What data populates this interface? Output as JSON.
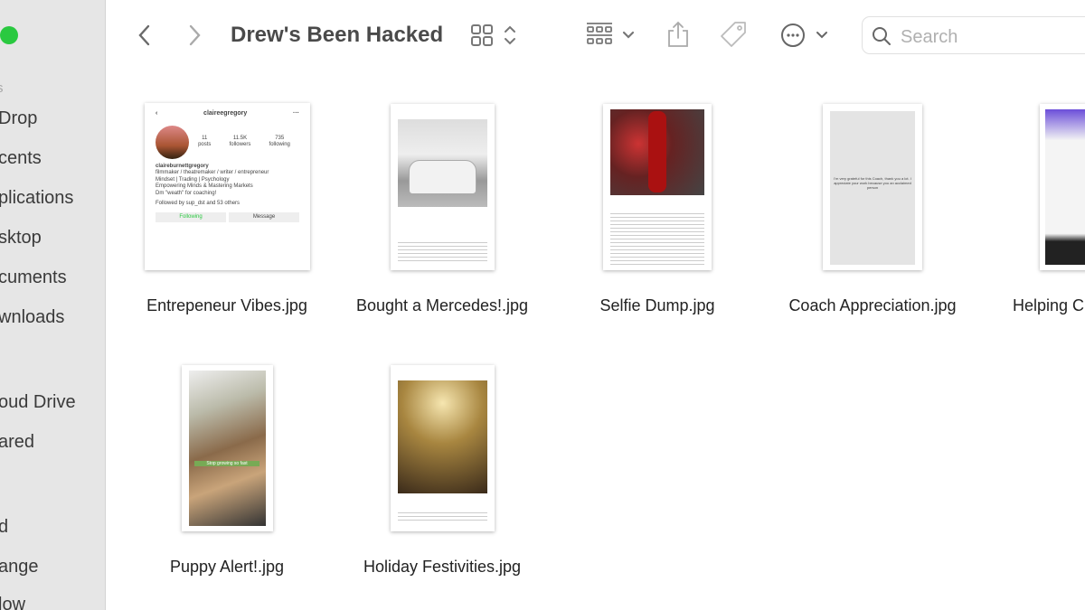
{
  "window": {
    "title": "Drew's Been Hacked"
  },
  "sidebar": {
    "section_favorites": "s",
    "items": [
      {
        "label": "Drop"
      },
      {
        "label": "cents"
      },
      {
        "label": "plications"
      },
      {
        "label": "sktop"
      },
      {
        "label": "cuments"
      },
      {
        "label": "wnloads"
      },
      {
        "label": "oud Drive"
      },
      {
        "label": "ared"
      },
      {
        "label": "d"
      },
      {
        "label": "ange"
      },
      {
        "label": "low"
      }
    ]
  },
  "toolbar": {
    "back_icon": "chevron-left",
    "forward_icon": "chevron-right",
    "view_icon": "grid-view",
    "group_icon": "group-by",
    "share_icon": "share",
    "tag_icon": "tag",
    "more_icon": "ellipsis-circle",
    "search_placeholder": "Search"
  },
  "files": [
    {
      "name": "Entrepeneur Vibes.jpg"
    },
    {
      "name": "Bought a Mercedes!.jpg"
    },
    {
      "name": "Selfie Dump.jpg"
    },
    {
      "name": "Coach Appreciation.jpg"
    },
    {
      "name": "Helping C"
    },
    {
      "name": "Puppy Alert!.jpg"
    },
    {
      "name": "Holiday Festivities.jpg"
    }
  ],
  "thumb1": {
    "username": "claireegregory",
    "posts": "11",
    "posts_label": "posts",
    "followers": "11.5K",
    "followers_label": "followers",
    "following": "735",
    "following_label": "following",
    "name": "claireburnettgregory",
    "bio1": "filmmaker / theatremaker / writer / entrepreneur",
    "bio2": "Mindset | Trading | Psychology",
    "bio3": "Empowering Minds & Mastering Markets",
    "bio4": "Dm \"weath\" for coaching!",
    "followed": "Followed by sup_dst and 53 others",
    "following_btn": "Following",
    "message_btn": "Message"
  },
  "thumb4": {
    "text": "I'm very grateful for this Coach, thank you a lot. I appreciate your work because you an acclaimed person"
  },
  "thumb6": {
    "caption": "Stop growing so fast"
  }
}
